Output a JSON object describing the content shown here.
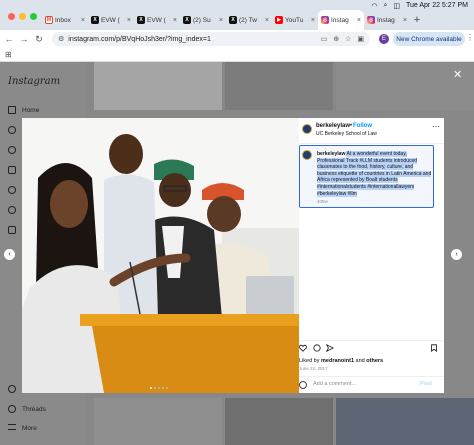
{
  "tabs": [
    {
      "title": "Inbox",
      "icon": "gmail-icon",
      "color": "#ea4335",
      "active": false
    },
    {
      "title": "EVW (",
      "icon": "x-icon",
      "color": "#111111",
      "active": false
    },
    {
      "title": "EVW (",
      "icon": "x-icon",
      "color": "#111111",
      "active": false
    },
    {
      "title": "(2) Su",
      "icon": "x-icon",
      "color": "#111111",
      "active": false
    },
    {
      "title": "(2) Tw",
      "icon": "x-icon",
      "color": "#111111",
      "active": false
    },
    {
      "title": "YouTu",
      "icon": "youtube-icon",
      "color": "#ff0000",
      "active": false
    },
    {
      "title": "Instag",
      "icon": "instagram-icon",
      "color": "#d62976",
      "active": true
    },
    {
      "title": "Instag",
      "icon": "instagram-icon",
      "color": "#d62976",
      "active": false
    }
  ],
  "menubar": {
    "datetime": "Tue Apr 22  5:27 PM"
  },
  "address": {
    "url": "instagram.com/p/BVqHoJsh3er/?img_index=1"
  },
  "profile_initial": "E",
  "new_chrome_label": "New Chrome available",
  "sidebar": {
    "logo": "Instagram",
    "items": [
      {
        "label": "Home",
        "icon": "home-icon"
      },
      {
        "label": "",
        "icon": "search-icon"
      },
      {
        "label": "",
        "icon": "explore-icon"
      },
      {
        "label": "",
        "icon": "reels-icon"
      },
      {
        "label": "",
        "icon": "messages-icon"
      },
      {
        "label": "",
        "icon": "notifications-icon"
      },
      {
        "label": "",
        "icon": "create-icon"
      }
    ],
    "bottom_items": [
      {
        "label": "",
        "icon": "meta-icon"
      },
      {
        "label": "Threads",
        "icon": "threads-icon"
      },
      {
        "label": "More",
        "icon": "menu-icon"
      }
    ]
  },
  "post": {
    "username": "berkeleylaw",
    "separator": "•",
    "follow_label": "Follow",
    "subtitle": "UC Berkeley School of Law",
    "caption_user": "berkeleylaw",
    "caption_plain": "At a wonderful event today, Professional Track #LLM students introduced classmates to the food, history, culture, and business etiquette of countries in Latin America and Africa represented by Boalt students #internationalstudents #internationallawyers #berkeleylaw #llm",
    "caption_time": "405w",
    "liked_by_prefix": "Liked by ",
    "liked_by_user": "medranoint1",
    "liked_by_suffix": " and ",
    "liked_by_others": "others",
    "date": "June 22, 2017",
    "comment_placeholder": "Add a comment...",
    "post_label": "Post",
    "image_dots": 5,
    "active_dot": 1
  },
  "colors": {
    "accent": "#0095f6",
    "highlight": "#b8d3f7",
    "selection_border": "#2f6cd4"
  }
}
